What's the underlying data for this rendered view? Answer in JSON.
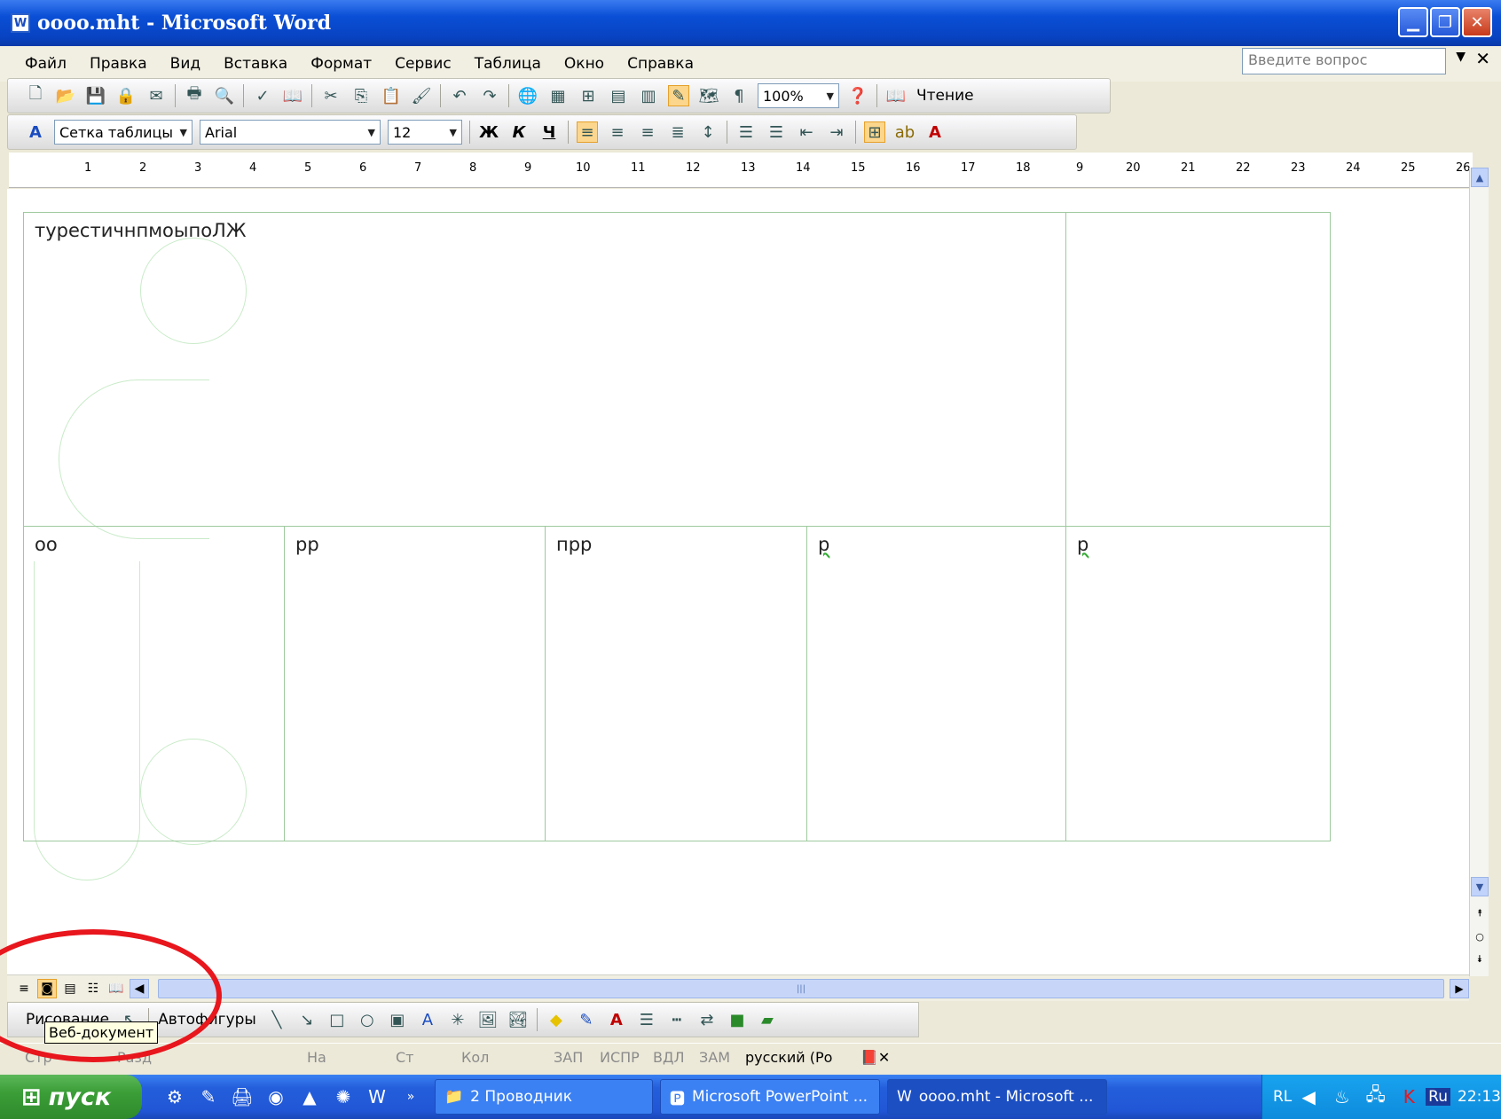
{
  "window": {
    "title": "oooo.mht - Microsoft Word"
  },
  "menu": {
    "items": [
      "Файл",
      "Правка",
      "Вид",
      "Вставка",
      "Формат",
      "Сервис",
      "Таблица",
      "Окно",
      "Справка"
    ],
    "ask_placeholder": "Введите вопрос"
  },
  "toolbar": {
    "zoom": "100%",
    "reading": "Чтение",
    "style": "Сетка таблицы",
    "font": "Arial",
    "size": "12",
    "bold": "Ж",
    "italic": "К",
    "underline": "Ч"
  },
  "ruler": {
    "marks": [
      "1",
      "2",
      "3",
      "4",
      "5",
      "6",
      "7",
      "8",
      "9",
      "10",
      "11",
      "12",
      "13",
      "14",
      "15",
      "16",
      "17",
      "18",
      "9",
      "20",
      "21",
      "22",
      "23",
      "24",
      "25",
      "26"
    ]
  },
  "document": {
    "cells": {
      "top_left": "турестичнпмоыпоЛЖ",
      "top_right": "",
      "b1": "оо",
      "b2": "рр",
      "b3": "прр",
      "b4": "р",
      "b5": "р"
    }
  },
  "drawing_toolbar": {
    "draw": "Рисование",
    "autoshapes": "Автофигуры"
  },
  "tooltip": "Веб-документ",
  "status": {
    "page": "Стр",
    "sec": "Разд",
    "at": "На",
    "ln": "Ст",
    "col": "Кол",
    "rec": "ЗАП",
    "trk": "ИСПР",
    "ext": "ВДЛ",
    "ovr": "ЗАМ",
    "lang": "русский (Ро"
  },
  "taskbar": {
    "start": "пуск",
    "tasks": [
      "2 Проводник",
      "Microsoft PowerPoint ...",
      "oooo.mht - Microsoft ..."
    ],
    "lang": "RL",
    "kbd": "Ru",
    "clock": "22:13"
  }
}
